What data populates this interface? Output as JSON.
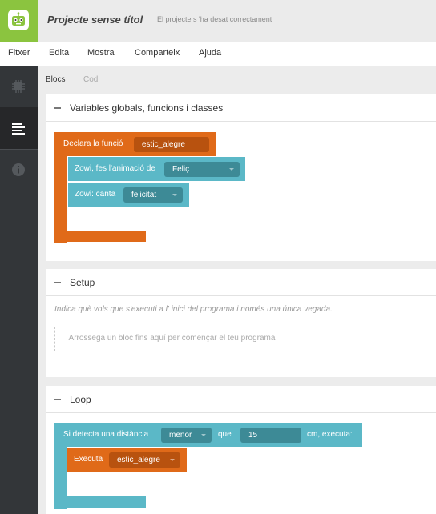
{
  "header": {
    "project_title": "Projecte sense títol",
    "save_status": "El projecte s 'ha desat correctament",
    "logo_icon": "robot-logo-icon"
  },
  "menu": {
    "items": [
      "Fitxer",
      "Edita",
      "Mostra",
      "Comparteix",
      "Ajuda"
    ]
  },
  "sidebar": {
    "icons": [
      "chip-icon",
      "list-icon",
      "info-icon"
    ],
    "active_index": 1
  },
  "tabs": {
    "blocks": "Blocs",
    "code": "Codi",
    "active": "Blocs"
  },
  "sections": {
    "globals": {
      "title": "Variables globals, funcions i classes",
      "function_block": {
        "label": "Declara la funció",
        "name": "estic_alegre",
        "body": [
          {
            "label": "Zowi, fes l'animació de",
            "value": "Feliç"
          },
          {
            "label": "Zowi: canta",
            "value": "felicitat"
          }
        ]
      }
    },
    "setup": {
      "title": "Setup",
      "hint": "Indica què vols que s'executi a l' inici del programa i només una única vegada.",
      "dropzone": "Arrossega un bloc fins aquí per començar el teu programa"
    },
    "loop": {
      "title": "Loop",
      "if_block": {
        "label": "Si detecta una distància",
        "comparator": "menor",
        "que": "que",
        "distance": "15",
        "suffix": "cm, executa:",
        "body": {
          "label": "Executa",
          "value": "estic_alegre"
        }
      }
    }
  },
  "colors": {
    "accent_green": "#8bc43f",
    "block_orange": "#e06a19",
    "block_teal": "#5bb8c7",
    "sidebar": "#333639"
  }
}
